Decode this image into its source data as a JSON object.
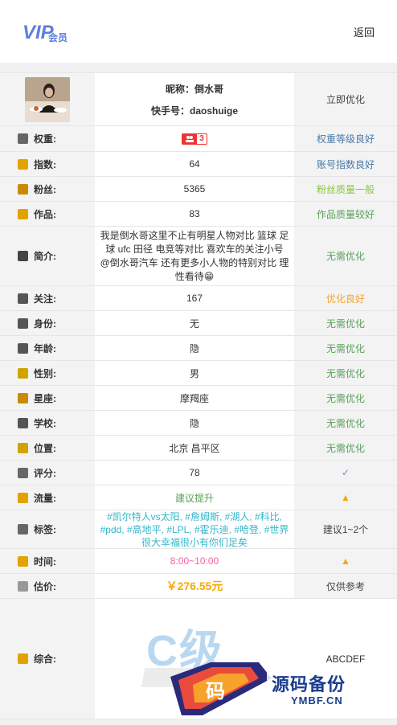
{
  "header": {
    "logo_text": "VIP会员",
    "back_label": "返回"
  },
  "profile": {
    "nickname_label": "昵称：",
    "nickname": "倒水哥",
    "kuaishou_label": "快手号：",
    "kuaishou_id": "daoshuige",
    "action": "立即优化"
  },
  "rows": [
    {
      "label": "权重:",
      "icon": "weight-icon",
      "value": "",
      "badge_level": "3",
      "status": "权重等级良好",
      "status_color": "#4a7aa8"
    },
    {
      "label": "指数:",
      "icon": "index-icon",
      "value": "64",
      "status": "账号指数良好",
      "status_color": "#4a7aa8"
    },
    {
      "label": "粉丝:",
      "icon": "fans-icon",
      "value": "5365",
      "status": "粉丝质量一般",
      "status_color": "#8cc540"
    },
    {
      "label": "作品:",
      "icon": "works-icon",
      "value": "83",
      "status": "作品质量较好",
      "status_color": "#5aa05a"
    },
    {
      "label": "简介:",
      "icon": "intro-icon",
      "value": "我是倒水哥这里不止有明星人物对比 篮球 足球 ufc 田径 电竞等对比 喜欢车的关注小号 @倒水哥汽车 还有更多小人物的特别对比 理性看待😁",
      "status": "无需优化",
      "status_color": "#5aa05a"
    },
    {
      "label": "关注:",
      "icon": "follow-icon",
      "value": "167",
      "status": "优化良好",
      "status_color": "#f3a52b"
    },
    {
      "label": "身份:",
      "icon": "identity-icon",
      "value": "无",
      "status": "无需优化",
      "status_color": "#5aa05a"
    },
    {
      "label": "年龄:",
      "icon": "age-icon",
      "value": "隐",
      "status": "无需优化",
      "status_color": "#5aa05a"
    },
    {
      "label": "性别:",
      "icon": "gender-icon",
      "value": "男",
      "status": "无需优化",
      "status_color": "#5aa05a"
    },
    {
      "label": "星座:",
      "icon": "zodiac-icon",
      "value": "摩羯座",
      "status": "无需优化",
      "status_color": "#5aa05a"
    },
    {
      "label": "学校:",
      "icon": "school-icon",
      "value": "隐",
      "status": "无需优化",
      "status_color": "#5aa05a"
    },
    {
      "label": "位置:",
      "icon": "location-icon",
      "value": "北京 昌平区",
      "status": "无需优化",
      "status_color": "#5aa05a"
    },
    {
      "label": "评分:",
      "icon": "score-icon",
      "value": "78",
      "status": "✓",
      "status_color": "#9c6fd6"
    },
    {
      "label": "流量:",
      "icon": "traffic-icon",
      "value": "建议提升",
      "value_color": "#5aa05a",
      "status": "▲",
      "status_color": "#f7a800"
    },
    {
      "label": "标签:",
      "icon": "tags-icon",
      "value": "#凯尔特人vs太阳, #詹姆斯, #湖人, #科比, #pdd, #高地平, #LPL, #霍乐迪, #哈登, #世界很大幸福很小有你们足矣",
      "value_color": "#35b6c9",
      "status": "建议1~2个",
      "status_color": "#444"
    },
    {
      "label": "时间:",
      "icon": "time-icon",
      "value": "8:00~10:00",
      "value_color": "#ff5ca5",
      "status": "▲",
      "status_color": "#f7a800"
    },
    {
      "label": "估价:",
      "icon": "price-icon",
      "value": "￥276.55元",
      "value_color": "#f7a800",
      "status": "仅供参考",
      "status_color": "#444"
    },
    {
      "label": "综合:",
      "icon": "overall-icon",
      "value": "C级",
      "status": "ABCDEF",
      "status_color": "#333"
    }
  ],
  "watermark": {
    "title": "源码备份",
    "sub": "YMBF.CN",
    "mark": "码"
  }
}
